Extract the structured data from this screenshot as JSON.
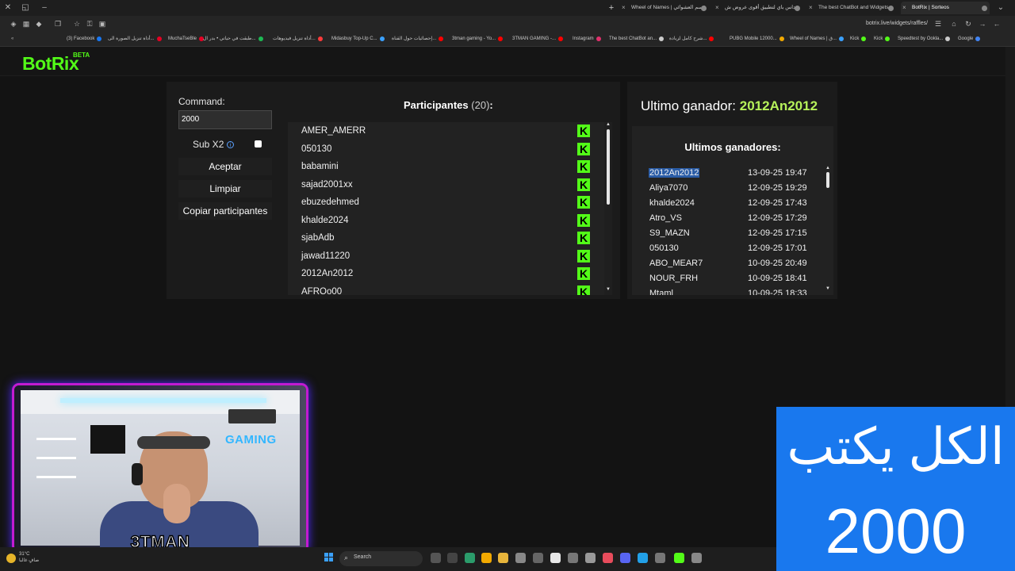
{
  "browser": {
    "tabs": [
      {
        "title": "Wheel of Names | قسم العشوائي",
        "active": false
      },
      {
        "title": "ميداس باي لتطبيق أقوى عروض ش",
        "active": false
      },
      {
        "title": "The best ChatBot and Widgets",
        "active": false
      },
      {
        "title": "BotRix | Sorteos",
        "active": true
      }
    ],
    "new_tab": "+",
    "url": "botrix.live/widgets/raffles/",
    "bookmarks": [
      {
        "label": "(3) Facebook",
        "color": "#1877f2"
      },
      {
        "label": "أداة تنزيل الصورة الى...",
        "color": "#e60023"
      },
      {
        "label": "MuchaTseBle",
        "color": "#e60023"
      },
      {
        "label": "طبقت في حياتي • بدر ال...",
        "color": "#1db954"
      },
      {
        "label": "أداة تنزيل فيديوهات...",
        "color": "#ff3b3b"
      },
      {
        "label": "Midasbuy Top-Up C...",
        "color": "#3ba1ff"
      },
      {
        "label": "إحصائيات حول القناة...",
        "color": "#ff0000"
      },
      {
        "label": "3tman gaming - Yo...",
        "color": "#ff0000"
      },
      {
        "label": "3TMAN GAMING -...",
        "color": "#ff0000"
      },
      {
        "label": "Instagram",
        "color": "#e1306c"
      },
      {
        "label": "The best ChatBot an...",
        "color": "#cccccc"
      },
      {
        "label": "شرح كامل لزيادة...",
        "color": "#ff0000"
      },
      {
        "label": "PUBG Mobile 12000...",
        "color": "#f2a900"
      },
      {
        "label": "Wheel of Names | ق...",
        "color": "#3ba1ff"
      },
      {
        "label": "Kick",
        "color": "#53fc18"
      },
      {
        "label": "Kick",
        "color": "#53fc18"
      },
      {
        "label": "Speedtest by Ookla...",
        "color": "#cccccc"
      },
      {
        "label": "Google",
        "color": "#4285f4"
      }
    ]
  },
  "app": {
    "logo": "BotRix",
    "beta": "BETA",
    "accent": "#53fc18"
  },
  "controls": {
    "command_label": "Command:",
    "command_value": "2000",
    "sub_label": "Sub X2",
    "accept_label": "Aceptar",
    "clear_label": "Limpiar",
    "copy_label": "Copiar participantes"
  },
  "participants": {
    "title": "Participantes",
    "count": "(20)",
    "colon": ":",
    "badge": "K",
    "items": [
      "AMER_AMERR",
      "050130",
      "babamini",
      "sajad2001xx",
      "ebuzedehmed",
      "khalde2024",
      "sjabAdb",
      "jawad11220",
      "2012An2012",
      "AFROo00"
    ]
  },
  "winner": {
    "label": "Ultimo ganador:",
    "name": "2012An2012",
    "history_title": "Ultimos ganadores:",
    "history": [
      {
        "name": "2012An2012",
        "date": "13-09-25 19:47"
      },
      {
        "name": "Aliya7070",
        "date": "12-09-25 19:29"
      },
      {
        "name": "khalde2024",
        "date": "12-09-25 17:43"
      },
      {
        "name": "Atro_VS",
        "date": "12-09-25 17:29"
      },
      {
        "name": "S9_MAZN",
        "date": "12-09-25 17:15"
      },
      {
        "name": "050130",
        "date": "12-09-25 17:01"
      },
      {
        "name": "ABO_MEAR7",
        "date": "10-09-25 20:49"
      },
      {
        "name": "NOUR_FRH",
        "date": "10-09-25 18:41"
      },
      {
        "name": "Mtaml",
        "date": "10-09-25 18:33"
      }
    ]
  },
  "overlay": {
    "streamer": "3TMAN",
    "neon_sign": "GAMING",
    "banner_text": "الكل يكتب",
    "banner_number": "2000"
  },
  "taskbar": {
    "temp": "31°C",
    "condition": "صافٍ غالبا",
    "search_placeholder": "Search"
  }
}
